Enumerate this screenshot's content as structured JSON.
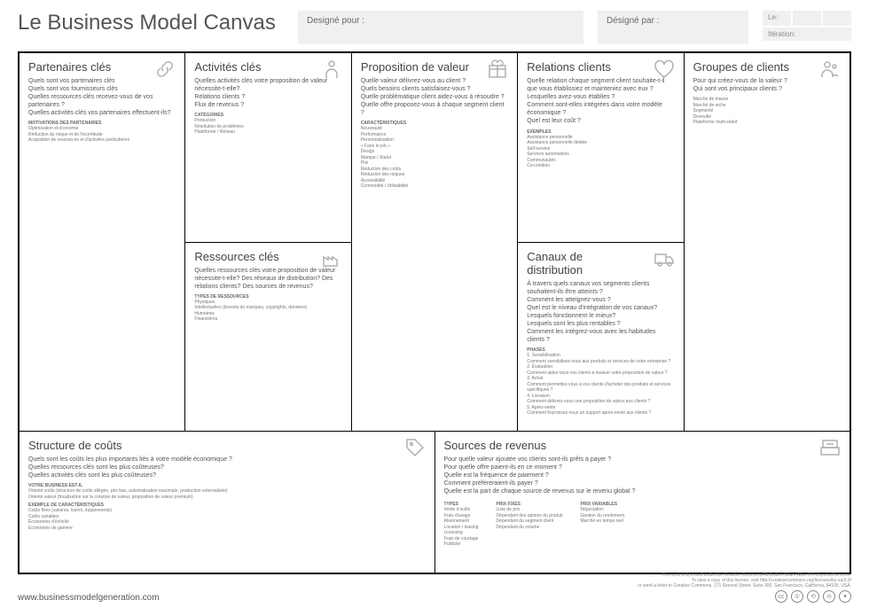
{
  "title": "Le Business Model Canvas",
  "header": {
    "designe_pour": "Designé pour :",
    "designe_par": "Désigné par :",
    "le": "Le:",
    "iteration": "Itération:"
  },
  "blocks": {
    "partners": {
      "title": "Partenaires clés",
      "q": "Quels sont vos partenaires clés\nQuels sont vos fournisseurs clés\nQuelles ressources clés recevez-vous de vos partenaires ?\nQuelles activités clés vos partenaires effectuent-ils?",
      "sub": "motivations des partenaires",
      "items": "Optimisation et économie\nRéduction du risque et de l'incertitude\nAcquisition de ressources et d'activités particulières"
    },
    "activities": {
      "title": "Activités clés",
      "q": "Quelles activités clés votre proposition de valeur nécessite-t-elle?\nRelations clients ?\nFlux de revenus ?",
      "sub": "catégories",
      "items": "Production\nRésolution de problèmes\nPlateforme / Réseau"
    },
    "resources": {
      "title": "Ressources clés",
      "q": "Quelles ressources clés votre proposition de valeur nécessite-t-elle? Des réseaux de distribution? Des relations clients? Des sources de revenus?",
      "sub": "types de ressources",
      "items": "Physiques\nIntellectuelles (brevets de marques, copyrights, données)\nHumaines\nFinancières"
    },
    "value": {
      "title": "Proposition de valeur",
      "q": "Quelle valeur délivrez-vous au client ?\nQuels besoins clients satisfaisez-vous ?\nQuelle problématique client aidez-vous à résoudre ?\nQuelle offre proposez-vous à chaque segment client ?",
      "sub": "caractéristiques",
      "items": "Nouveauté\nPerformance\nPersonnalisation\n« Faire le job »\nDesign\nMarque / Statut\nPrix\nRéduction des coûts\nRéduction des risques\nAccessibilité\nCommodité / Utilisabilité"
    },
    "relations": {
      "title": "Relations clients",
      "q": "Quelle relation chaque segment client souhaite-t-il que vous établissiez et mainteniez avec eux ?\nLesquelles avez-vous établies ?\nComment sont-elles intégrées dans votre modèle économique ?\nQuel est leur coût ?",
      "sub": "exemples",
      "items": "Assistance personnelle\nAssistance personnelle dédiée\nSelf-service\nServices automatisés\nCommunautés\nCo-création"
    },
    "channels": {
      "title": "Canaux de distribution",
      "q": "À travers quels canaux vos segments clients souhaitent-ils être atteints ?\nComment les atteignez-vous ?\nQuel est le niveau d'intégration de vos canaux?\nLesquels fonctionnent le mieux?\nLesquels sont les plus rentables ?\nComment les intégrez-vous avec les habitudes clients ?",
      "sub": "phases",
      "items": "1. Sensibilisation\n  Comment sensibilisez-vous aux produits et services de votre entreprise ?\n2. Évaluation\n  Comment aidez-vous vos clients à évaluer votre proposition de valeur ?\n3. Achat\n  Comment permettez-vous à vos clients d'acheter des produits et services spécifiques ?\n4. Livraison\n  Comment délivrez-vous une proposition de valeur aux clients ?\n5. Après-vente\n  Comment fournissez-vous un support après-vente aux clients ?"
    },
    "segments": {
      "title": "Groupes de clients",
      "q": "Pour qui créez-vous de la valeur ?\nQui sont vos principaux clients ?",
      "items": "Marché de masse\nMarché de niche\nSegmenté\nDiversifié\nPlateforme multi-sided"
    },
    "costs": {
      "title": "Structure de coûts",
      "q": "Quels sont les coûts les plus importants liés à votre modèle économique ?\nQuelles ressources clés sont les plus coûteuses?\nQuelles activités clés sont les plus coûteuses?",
      "sub1": "votre business est-il",
      "items1": "Orienté coûts (structure de coûts allégée, prix bas, automatisation maximale, production externalisée)\nOrienté valeur (focalisation sur la création de valeur, proposition de valeur premium)",
      "sub2": "exemple de caractéristiques",
      "items2": "Coûts fixes (salaires, loyers, équipements)\nCoûts variables\nÉconomies d'échelle\nÉconomies de gamme"
    },
    "revenue": {
      "title": "Sources de revenus",
      "q": "Pour quelle valeur ajoutée vos clients sont-ils prêts à payer ?\nPour quelle offre paient-ils en ce moment ?\nQuelle est la fréquence de paiement ?\nComment préféreraient-ils payer ?\nQuelle est la part de chaque source de revenus sur le revenu global ?",
      "col1_h": "types",
      "col1": "Vente d'actifs\nFrais d'usage\nAbonnement\nLocation / leasing\nLicensing\nFrais de courtage\nPublicité",
      "col2_h": "prix fixés",
      "col2": "Liste de prix\nDépendant des options du produit\nDépendant du segment client\nDépendant du volume",
      "col3_h": "prix variables",
      "col3": "Négociation\nGestion du rendement\nMarché en temps réel"
    }
  },
  "footer": {
    "url": "www.businessmodelgeneration.com",
    "license": "This work is licensed under the Creative Commons Attribution-Share Alike 3.0 Unported License.\nTo view a copy of this license, visit http://creativecommons.org/licenses/by-sa/3.0/\nor send a letter to Creative Commons, 171 Second Street, Suite 300, San Francisco, California, 94105, USA."
  }
}
